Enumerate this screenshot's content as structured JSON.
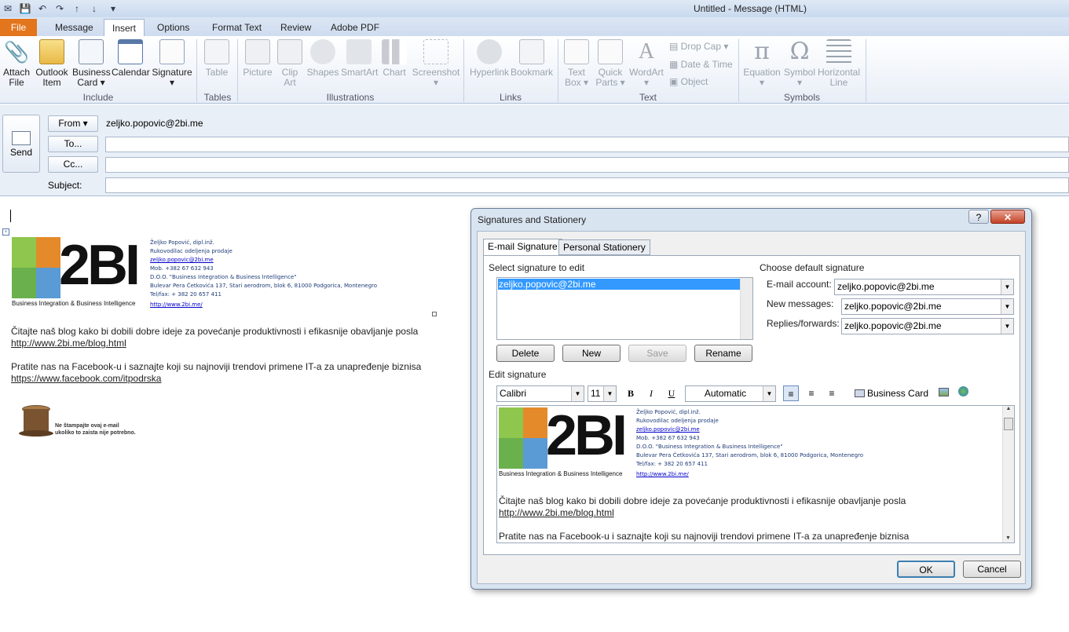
{
  "window": {
    "title": "Untitled  -  Message (HTML)"
  },
  "tabs": [
    "File",
    "Message",
    "Insert",
    "Options",
    "Format Text",
    "Review",
    "Adobe PDF"
  ],
  "ribbon": {
    "attach_file": "Attach\nFile",
    "attach_file_l1": "Attach",
    "attach_file_l2": "File",
    "outlook_item_l1": "Outlook",
    "outlook_item_l2": "Item",
    "business_card_l1": "Business",
    "business_card_l2": "Card ▾",
    "calendar": "Calendar",
    "signature_l1": "Signature",
    "signature_l2": "▾",
    "group_include": "Include",
    "table": "Table",
    "group_tables": "Tables",
    "picture": "Picture",
    "clip_art_l1": "Clip",
    "clip_art_l2": "Art",
    "shapes": "Shapes",
    "smartart": "SmartArt",
    "chart": "Chart",
    "screenshot": "Screenshot",
    "group_illustrations": "Illustrations",
    "hyperlink": "Hyperlink",
    "bookmark": "Bookmark",
    "group_links": "Links",
    "text_box_l1": "Text",
    "text_box_l2": "Box ▾",
    "quick_parts_l1": "Quick",
    "quick_parts_l2": "Parts ▾",
    "wordart": "WordArt",
    "drop_cap": "Drop Cap ▾",
    "date_time": "Date & Time",
    "object": "Object",
    "group_text": "Text",
    "equation": "Equation",
    "symbol": "Symbol",
    "horizontal_line_l1": "Horizontal",
    "horizontal_line_l2": "Line",
    "group_symbols": "Symbols"
  },
  "compose": {
    "send": "Send",
    "from_button": "From ▾",
    "from_value": "zeljko.popovic@2bi.me",
    "to_button": "To...",
    "cc_button": "Cc...",
    "subject_label": "Subject:"
  },
  "signature": {
    "logo_text": "2BI",
    "logo_sub": "Business Integration & Business Intelligence",
    "lines": [
      "Željko Popović, dipl.inž.",
      "Rukovodilac odeljenja prodaje",
      "zeljko.popovic@2bi.me",
      "Mob. +382 67 632 943",
      "D.O.O. \"Business Integration & Business Intelligence\"",
      "Bulevar Pera Ćetkovića 137, Stari aerodrom, blok 6, 81000 Podgorica, Montenegro",
      "Tel/fax: + 382 20 657 411",
      "http://www.2bi.me/"
    ],
    "blog_text": "Čitajte  naš blog kako bi dobili dobre ideje za povećanje produktivnosti i efikasnije obavljanje posla",
    "blog_link": "http://www.2bi.me/blog.html",
    "fb_text": "Pratite nas na Facebook-u i saznajte koji su najnoviji trendovi primene IT-a za unapređenje biznisa",
    "fb_link": "https://www.facebook.com/itpodrska",
    "eco_l1": "Ne štampajte ovaj e-mail",
    "eco_l2": "ukoliko to zaista nije potrebno."
  },
  "dialog": {
    "title": "Signatures and Stationery",
    "help": "?",
    "close": "✕",
    "tab_email": "E-mail Signature",
    "tab_stationery": "Personal Stationery",
    "select_label": "Select signature to edit",
    "signatures": [
      "zeljko.popovic@2bi.me"
    ],
    "delete": "Delete",
    "new": "New",
    "save": "Save",
    "rename": "Rename",
    "choose_default": "Choose default signature",
    "email_account_label": "E-mail account:",
    "email_account_value": "zeljko.popovic@2bi.me",
    "new_messages_label": "New messages:",
    "new_messages_value": "zeljko.popovic@2bi.me",
    "replies_label": "Replies/forwards:",
    "replies_value": "zeljko.popovic@2bi.me",
    "edit_label": "Edit signature",
    "font": "Calibri",
    "size": "11",
    "bold": "B",
    "italic": "I",
    "underline": "U",
    "color": "Automatic",
    "business_card": "Business Card",
    "ok": "OK",
    "cancel": "Cancel"
  },
  "colors": {
    "file_tab": "#e3751c",
    "link": "#0000cc",
    "sig_text": "#1f3c78",
    "selection": "#3399ff"
  }
}
